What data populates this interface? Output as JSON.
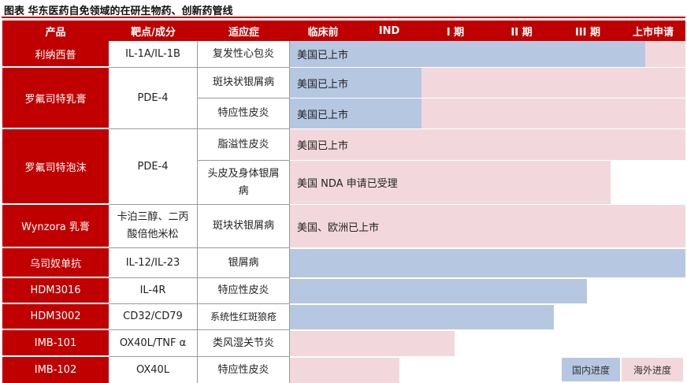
{
  "caption": "图表 华东医药自免领域的在研生物药、创新药管线",
  "headers": [
    "产品",
    "靶点/成分",
    "适应症",
    "临床前",
    "IND",
    "I 期",
    "II 期",
    "III 期",
    "上市申请"
  ],
  "rows": [
    {
      "product": "利纳西普",
      "target": "IL-1A/IL-1B",
      "indication": "复发性心包炎",
      "domestic_bar": "",
      "overseas_bar": "美国已上市"
    },
    {
      "product": "罗氟司特乳膏",
      "target": "PDE-4",
      "indication": "斑块状银屑病",
      "domestic_bar": "美国已上市",
      "overseas_bar": ""
    },
    {
      "product": "罗氟司特乳膏",
      "target": "PDE-4",
      "indication": "特应性皮炎",
      "domestic_bar": "美国已上市",
      "overseas_bar": ""
    },
    {
      "product": "罗氟司特泡沫",
      "target": "PDE-4",
      "indication": "脂溢性皮炎",
      "domestic_bar": "",
      "overseas_bar": "美国已上市"
    },
    {
      "product": "罗氟司特泡沫",
      "target": "PDE-4",
      "indication": "头皮及身体银屑病",
      "domestic_bar": "",
      "overseas_bar": "美国 NDA 申请已受理"
    },
    {
      "product": "Wynzora 乳膏",
      "target": "卡泊三醇、二丙酸倍他米松",
      "indication": "斑块状银屑病",
      "domestic_bar": "",
      "overseas_bar": "美国、欧洲已上市"
    },
    {
      "product": "乌司奴单抗",
      "target": "IL-12/IL-23",
      "indication": "银屑病",
      "domestic_bar": "",
      "overseas_bar": ""
    },
    {
      "product": "HDM3016",
      "target": "IL-4R",
      "indication": "特应性皮炎",
      "domestic_bar": "",
      "overseas_bar": ""
    },
    {
      "product": "HDM3002",
      "target": "CD32/CD79",
      "indication": "系统性红斑狼疮",
      "domestic_bar": "",
      "overseas_bar": ""
    },
    {
      "product": "IMB-101",
      "target": "OX40L/TNF α",
      "indication": "类风湿关节炎",
      "domestic_bar": "",
      "overseas_bar": ""
    },
    {
      "product": "IMB-102",
      "target": "OX40L",
      "indication": "特应性皮炎",
      "domestic_bar": "",
      "overseas_bar": ""
    }
  ],
  "legend": {
    "domestic": "国内进度",
    "overseas": "海外进度"
  },
  "colors": {
    "header": "#c00000",
    "domestic": "#b6c7e2",
    "overseas": "#f2d8dc"
  }
}
